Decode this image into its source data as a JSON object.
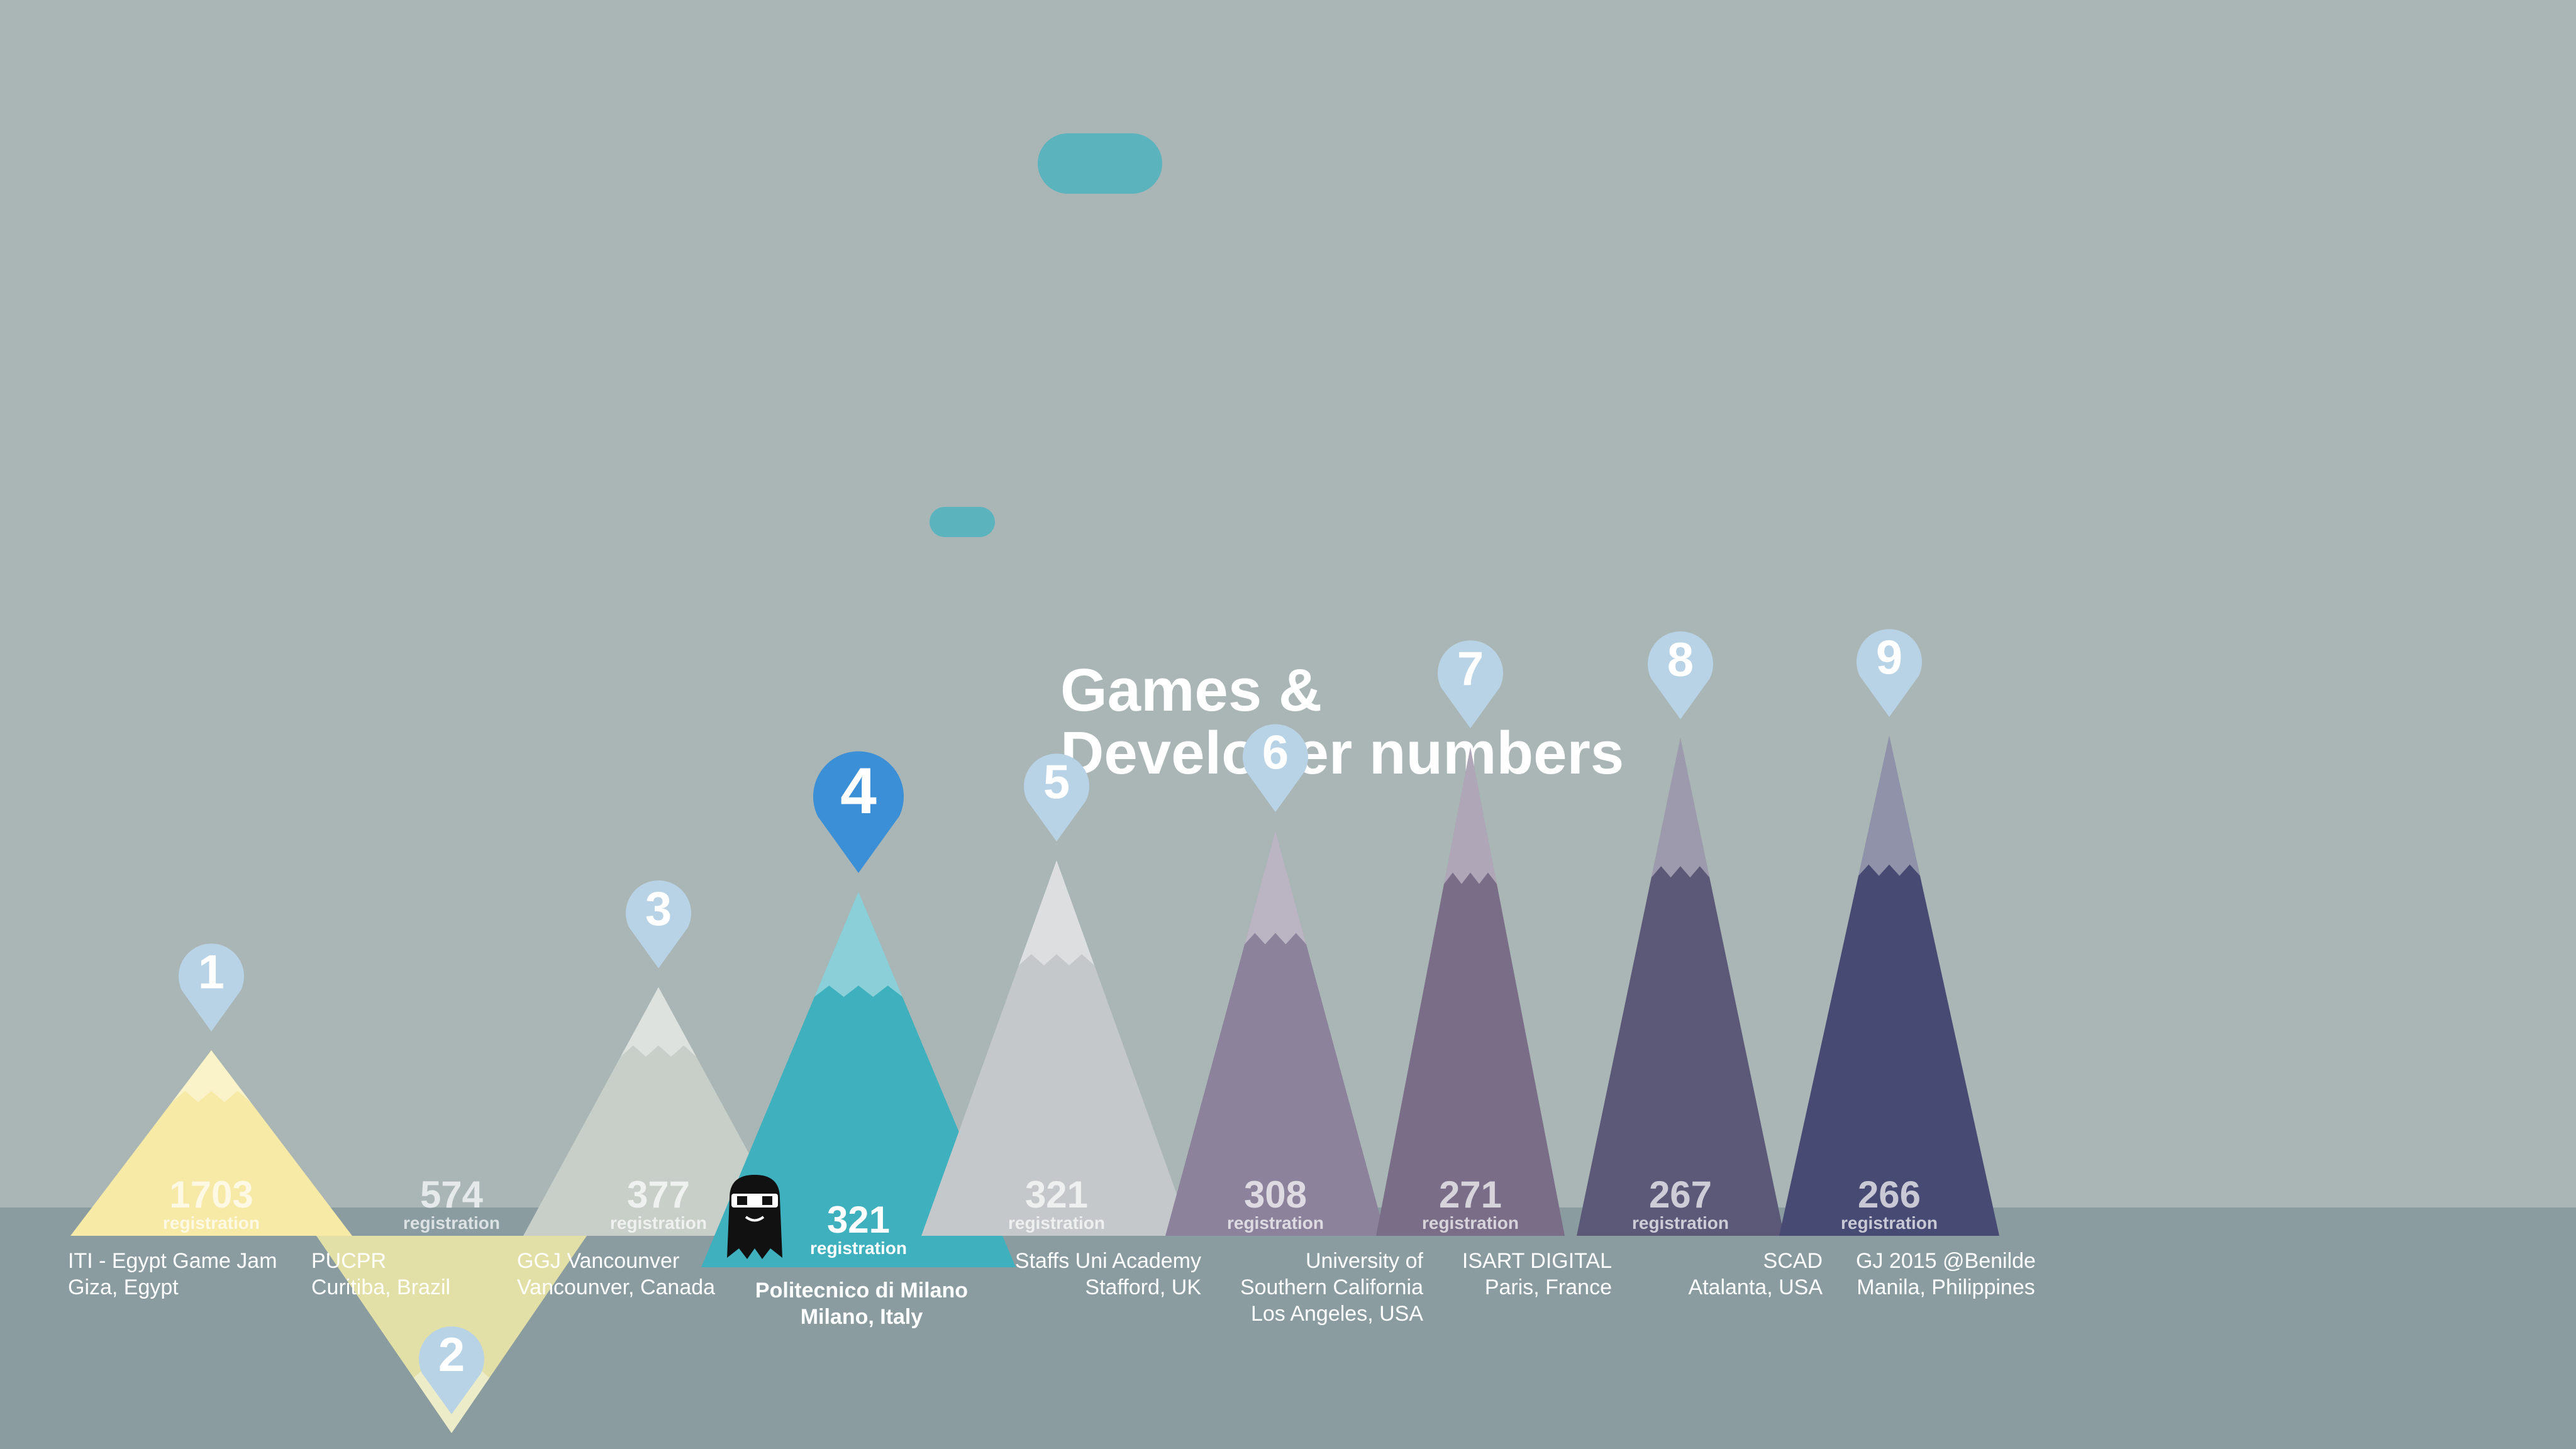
{
  "title_lines": [
    "Games &",
    "Developer numbers"
  ],
  "chart_data": {
    "type": "bar",
    "title": "Games & Developer numbers",
    "categories": [
      "ITI - Egypt Game Jam Giza, Egypt",
      "PUCPR Curitiba, Brazil",
      "GGJ Vancounver Vancounver, Canada",
      "Politecnico di Milano Milano, Italy",
      "Staffs Uni Academy Stafford, UK",
      "University of Southern California Los Angeles, USA",
      "ISART DIGITAL Paris, France",
      "SCAD Atalanta, USA",
      "GJ 2015 @Benilde Manila, Philippines"
    ],
    "values": [
      1703,
      574,
      377,
      321,
      321,
      308,
      271,
      267,
      266
    ],
    "unit_label": "registration",
    "ranks": [
      "1",
      "2",
      "3",
      "4",
      "5",
      "6",
      "7",
      "8",
      "9"
    ],
    "labels": [
      [
        "ITI - Egypt Game Jam",
        "Giza, Egypt"
      ],
      [
        "PUCPR",
        "Curitiba, Brazil"
      ],
      [
        "GGJ Vancounver",
        "Vancounver, Canada"
      ],
      [
        "Politecnico di Milano",
        "Milano, Italy"
      ],
      [
        "Staffs Uni Academy",
        "Stafford, UK"
      ],
      [
        "University of",
        "Southern California",
        "Los Angeles, USA"
      ],
      [
        "ISART DIGITAL",
        "Paris, France"
      ],
      [
        "SCAD",
        "Atalanta, USA"
      ],
      [
        "GJ 2015 @Benilde",
        "Manila, Philippines"
      ]
    ],
    "highlighted_index": 3,
    "colors": [
      "#f7e9a6",
      "#e2e0a6",
      "#c7cfc8",
      "#3fb0be",
      "#c5c8ca",
      "#8c829c",
      "#7a6d88",
      "#5c5878",
      "#474a72"
    ]
  }
}
